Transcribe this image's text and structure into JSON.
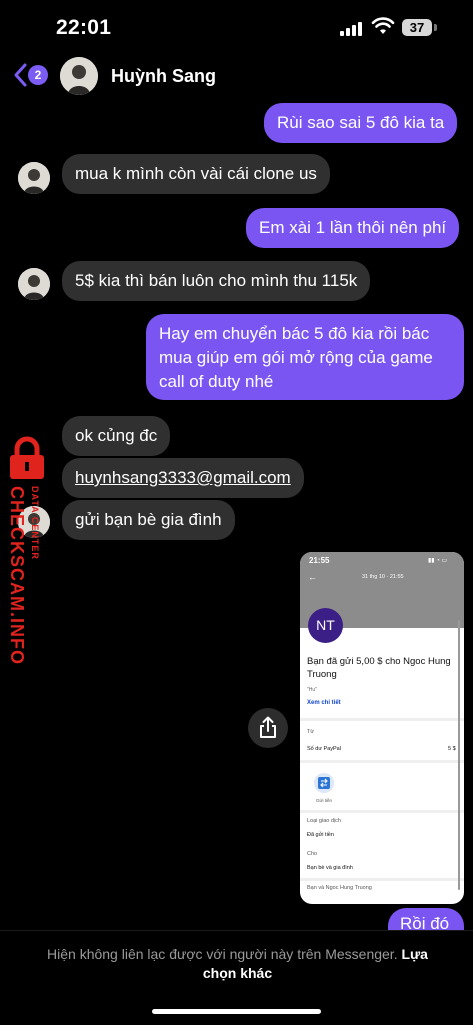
{
  "status_bar": {
    "time": "22:01",
    "battery": "37"
  },
  "header": {
    "back_badge": "2",
    "name": "Huỳnh Sang"
  },
  "messages": [
    {
      "dir": "out",
      "text": "Rùi sao sai 5 đô kia ta"
    },
    {
      "dir": "in",
      "text": "mua k mình còn vài cái clone us"
    },
    {
      "dir": "out",
      "text": "Em xài 1 lần thôi nên phí"
    },
    {
      "dir": "in",
      "text": "5$ kia thì bán luôn cho mình thu 115k"
    },
    {
      "dir": "out",
      "lines": [
        "Hay em chuyển bác 5 đô kia rồi bác",
        "mua giúp em gói mở rộng của game",
        "call of duty nhé"
      ]
    },
    {
      "dir": "in",
      "text": "ok củng đc"
    },
    {
      "dir": "in",
      "text": "huynhsang3333@gmail.com"
    },
    {
      "dir": "in",
      "text": "gửi bạn bè gia đình"
    },
    {
      "dir": "out",
      "text": "Rồi đó"
    }
  ],
  "watermark": {
    "text": "CHECKSCAM.INFO",
    "sub": "DATA CENTER"
  },
  "screenshot": {
    "time": "21:55",
    "date": "31 thg 10 · 21:55",
    "avatar_initials": "NT",
    "title": "Bạn đã gửi 5,00 $ cho Ngoc Hung Truong",
    "note": "\"Hu\"",
    "details_link": "Xem chi tiết",
    "from_label": "Từ",
    "from_value": "Số dư PayPal",
    "amount": "5 $",
    "send_label": "Gửi tiền",
    "type_label": "Loại giao dịch",
    "type_value": "Đã gửi tiền",
    "for_label": "Cho",
    "for_value": "Bạn bè và gia đình",
    "with_label": "Bạn và Ngoc Hung Truong"
  },
  "footer": {
    "text": "Hiện không liên lạc được với người này trên Messenger.",
    "link": "Lựa chọn khác"
  },
  "colors": {
    "accent": "#7a55f1",
    "incoming": "#303030",
    "watermark": "#e1231e"
  }
}
